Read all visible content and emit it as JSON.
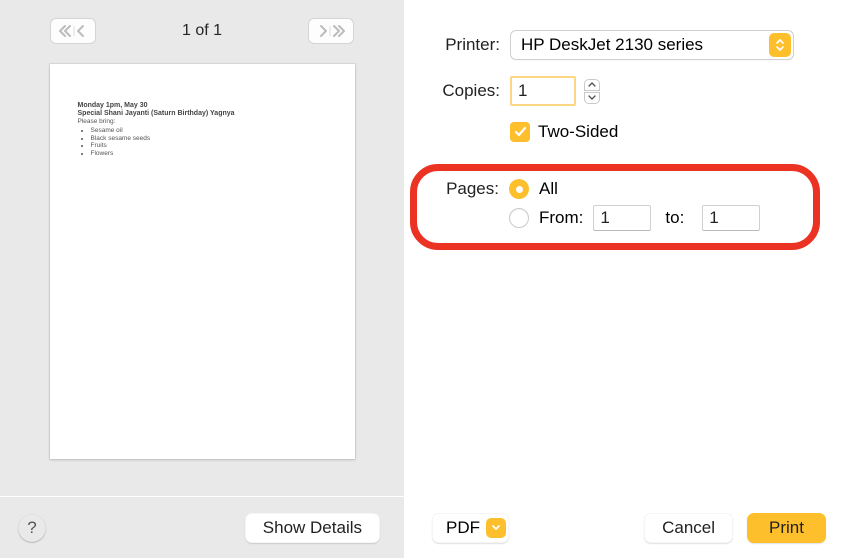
{
  "pageIndicator": "1 of 1",
  "preview": {
    "line1": "Monday 1pm, May 30",
    "line2": "Special Shani Jayanti (Saturn Birthday) Yagnya",
    "line3": "Please bring:",
    "items": [
      "Sesame oil",
      "Black sesame seeds",
      "Fruits",
      "Flowers"
    ]
  },
  "labels": {
    "printer": "Printer:",
    "copies": "Copies:",
    "twoSided": "Two-Sided",
    "pages": "Pages:",
    "all": "All",
    "from": "From:",
    "to": "to:"
  },
  "values": {
    "printer": "HP DeskJet 2130 series",
    "copies": "1",
    "twoSidedChecked": true,
    "pagesMode": "all",
    "from": "1",
    "to": "1"
  },
  "buttons": {
    "showDetails": "Show Details",
    "pdf": "PDF",
    "cancel": "Cancel",
    "print": "Print",
    "help": "?"
  }
}
